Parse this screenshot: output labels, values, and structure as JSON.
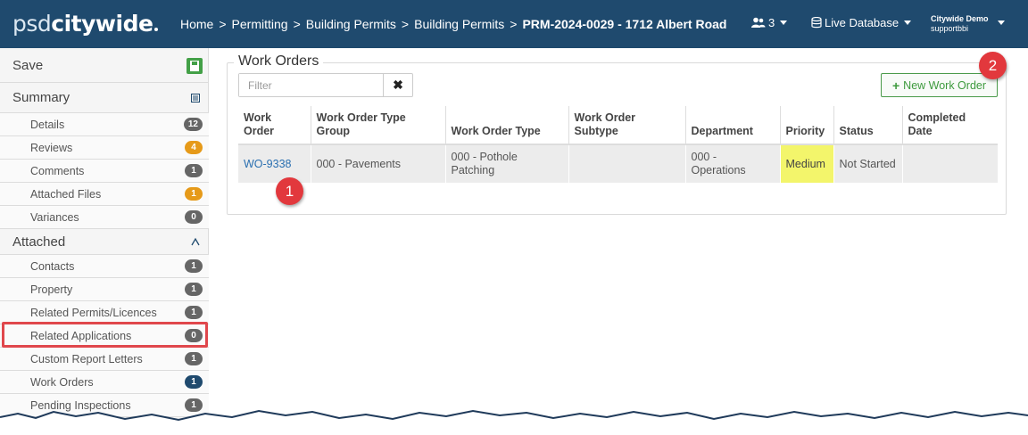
{
  "header": {
    "logo_light": "psd",
    "logo_bold": "citywide",
    "breadcrumbs": [
      "Home",
      "Permitting",
      "Building Permits",
      "Building Permits"
    ],
    "breadcrumb_sep": ">",
    "breadcrumb_current": "PRM-2024-0029 - 1712 Albert Road",
    "users_count": "3",
    "database_label": "Live Database",
    "user_name": "Citywide Demo",
    "user_login": "supportbbi"
  },
  "sidebar": {
    "save_label": "Save",
    "summary_label": "Summary",
    "summary_items": [
      {
        "label": "Details",
        "count": "12",
        "color": "gray"
      },
      {
        "label": "Reviews",
        "count": "4",
        "color": "orange"
      },
      {
        "label": "Comments",
        "count": "1",
        "color": "gray"
      },
      {
        "label": "Attached Files",
        "count": "1",
        "color": "orange"
      },
      {
        "label": "Variances",
        "count": "0",
        "color": "gray"
      }
    ],
    "attached_label": "Attached",
    "attached_items": [
      {
        "label": "Contacts",
        "count": "1"
      },
      {
        "label": "Property",
        "count": "1"
      },
      {
        "label": "Related Permits/Licences",
        "count": "1"
      },
      {
        "label": "Related Applications",
        "count": "0"
      },
      {
        "label": "Custom Report Letters",
        "count": "1"
      },
      {
        "label": "Work Orders",
        "count": "1",
        "active": true
      },
      {
        "label": "Pending Inspections",
        "count": "1"
      }
    ]
  },
  "main": {
    "section_title": "Work Orders",
    "filter_placeholder": "Filter",
    "clear_glyph": "✖",
    "new_button_label": "New Work Order",
    "columns": [
      "Work Order",
      "Work Order Type Group",
      "Work Order Type",
      "Work Order Subtype",
      "Department",
      "Priority",
      "Status",
      "Completed Date"
    ],
    "rows": [
      {
        "work_order": "WO-9338",
        "type_group": "000 - Pavements",
        "type": "000 - Pothole Patching",
        "subtype": "",
        "department": "000 - Operations",
        "priority": "Medium",
        "status": "Not Started",
        "completed_date": ""
      }
    ]
  },
  "callouts": [
    "1",
    "2"
  ],
  "colors": {
    "header_bg": "#1f4a6e",
    "callout": "#e2383d",
    "priority_medium": "#f3f56b",
    "button_green": "#3d9a3d"
  }
}
